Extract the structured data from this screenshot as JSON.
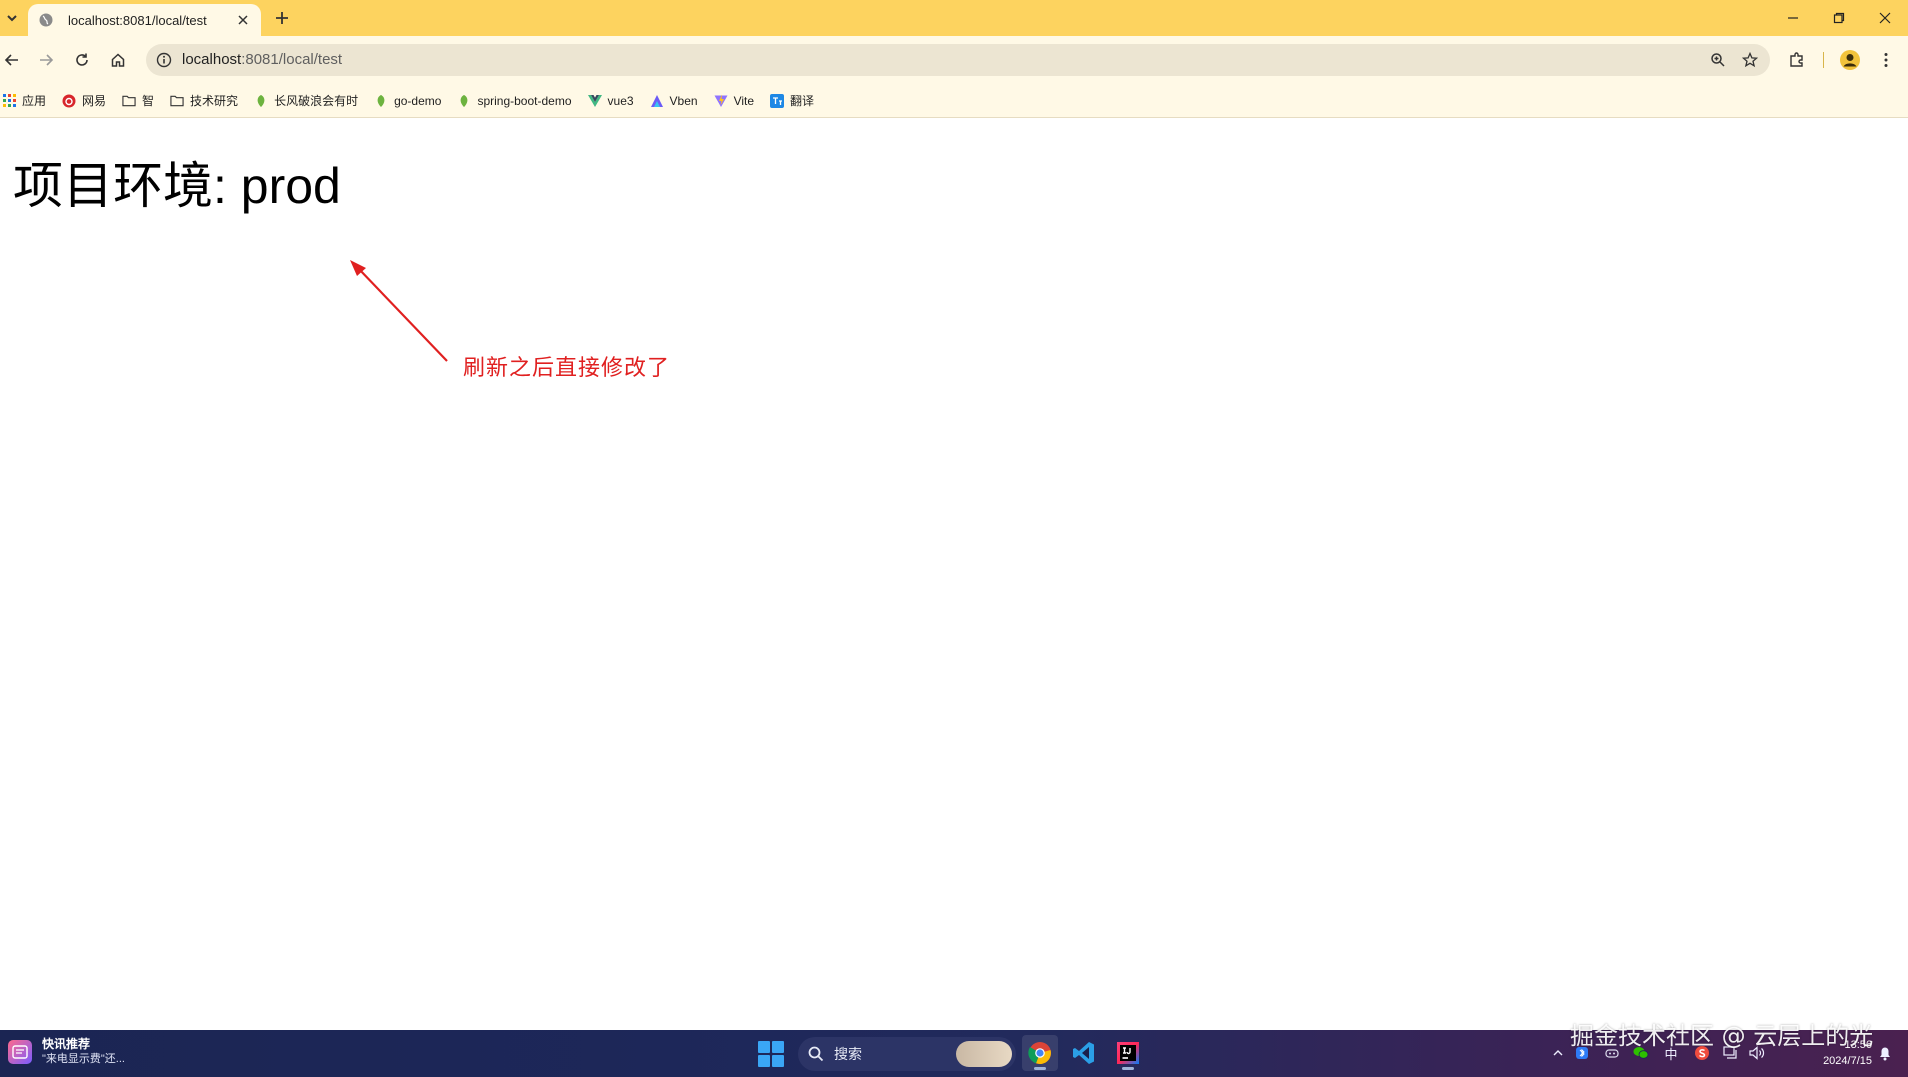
{
  "browser": {
    "tab": {
      "title": "localhost:8081/local/test"
    },
    "new_tab_label": "+",
    "address": {
      "host": "localhost",
      "rest": ":8081/local/test"
    }
  },
  "bookmarks": [
    {
      "label": "应用",
      "icon": "apps-grid-icon"
    },
    {
      "label": "网易",
      "icon": "netease-icon"
    },
    {
      "label": "智",
      "icon": "folder-icon"
    },
    {
      "label": "技术研究",
      "icon": "folder-icon"
    },
    {
      "label": "长风破浪会有时",
      "icon": "leaf-icon"
    },
    {
      "label": "go-demo",
      "icon": "leaf-icon"
    },
    {
      "label": "spring-boot-demo",
      "icon": "leaf-icon"
    },
    {
      "label": "vue3",
      "icon": "vue-icon"
    },
    {
      "label": "Vben",
      "icon": "vben-icon"
    },
    {
      "label": "Vite",
      "icon": "vite-icon"
    },
    {
      "label": "翻译",
      "icon": "translate-icon"
    }
  ],
  "page": {
    "heading": "项目环境: prod",
    "annotation": "刷新之后直接修改了"
  },
  "taskbar": {
    "news_title": "快讯推荐",
    "news_subtitle": "\"来电显示费\"还...",
    "search_placeholder": "搜索",
    "ime": "中",
    "time": "13:56",
    "date": "2024/7/15"
  },
  "watermark": "掘金技术社区 @ 云层上的光",
  "colors": {
    "tabstrip": "#fdd35f",
    "toolbar": "#fff9e6",
    "annotation": "#e02020"
  }
}
